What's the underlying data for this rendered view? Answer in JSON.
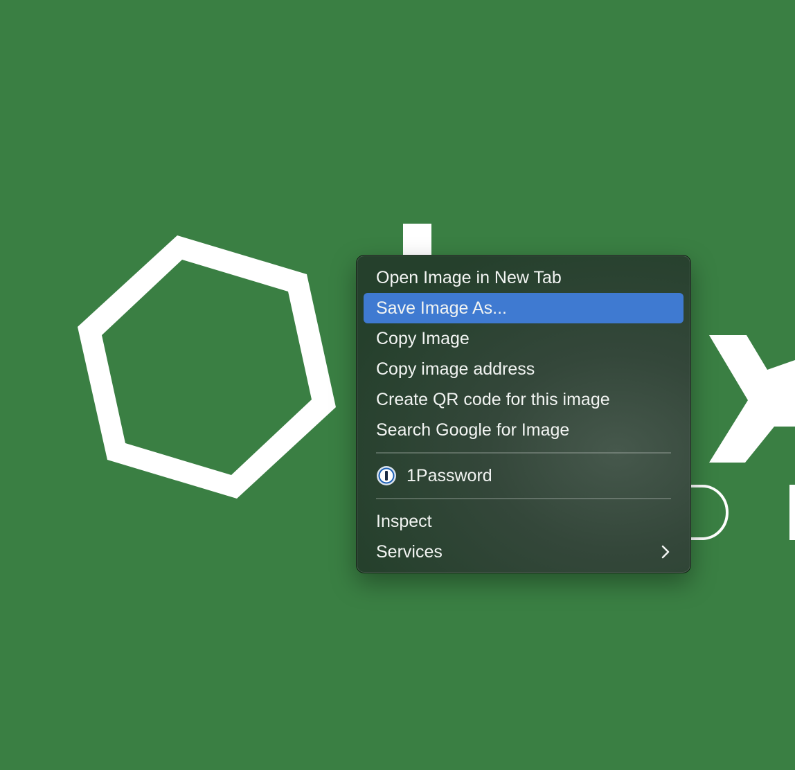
{
  "context_menu": {
    "items": [
      {
        "label": "Open Image in New Tab"
      },
      {
        "label": "Save Image As...",
        "highlighted": true
      },
      {
        "label": "Copy Image"
      },
      {
        "label": "Copy image address"
      },
      {
        "label": "Create QR code for this image"
      },
      {
        "label": "Search Google for Image"
      }
    ],
    "extension_item": {
      "label": "1Password",
      "icon": "1password-icon"
    },
    "bottom_items": [
      {
        "label": "Inspect"
      },
      {
        "label": "Services",
        "icon": "chevron-right-icon"
      }
    ]
  },
  "colors": {
    "background": "#3a7f43",
    "highlight": "#3f7ad1",
    "menu_text": "#f2f4f2"
  }
}
